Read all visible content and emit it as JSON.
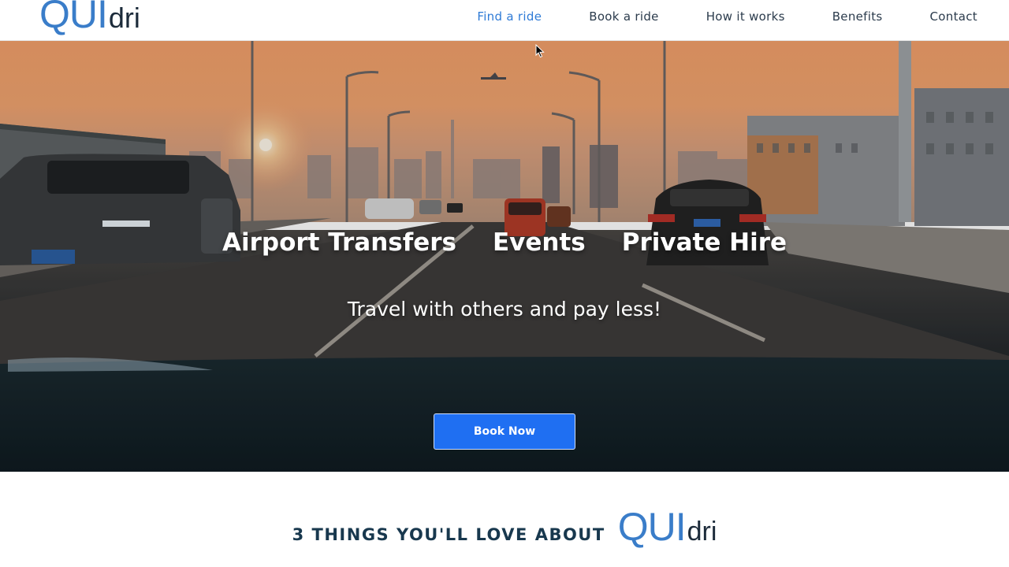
{
  "brand": {
    "logo_main": "QUI",
    "logo_sub": "dri",
    "primary_color": "#3a7dc9",
    "dark_color": "#1c2b3a"
  },
  "nav": {
    "items": [
      {
        "label": "Find a ride",
        "active": true
      },
      {
        "label": "Book a ride",
        "active": false
      },
      {
        "label": "How it works",
        "active": false
      },
      {
        "label": "Benefits",
        "active": false
      },
      {
        "label": "Contact",
        "active": false
      }
    ],
    "active_color": "#2f7bd6"
  },
  "hero": {
    "services": [
      "Airport Transfers",
      "Events",
      "Private Hire"
    ],
    "tagline": "Travel with others and pay less!",
    "cta_label": "Book Now",
    "cta_color": "#1f6ff2"
  },
  "section": {
    "title_text": "3 THINGS YOU'LL LOVE ABOUT",
    "logo_main": "QUI",
    "logo_sub": "dri"
  }
}
